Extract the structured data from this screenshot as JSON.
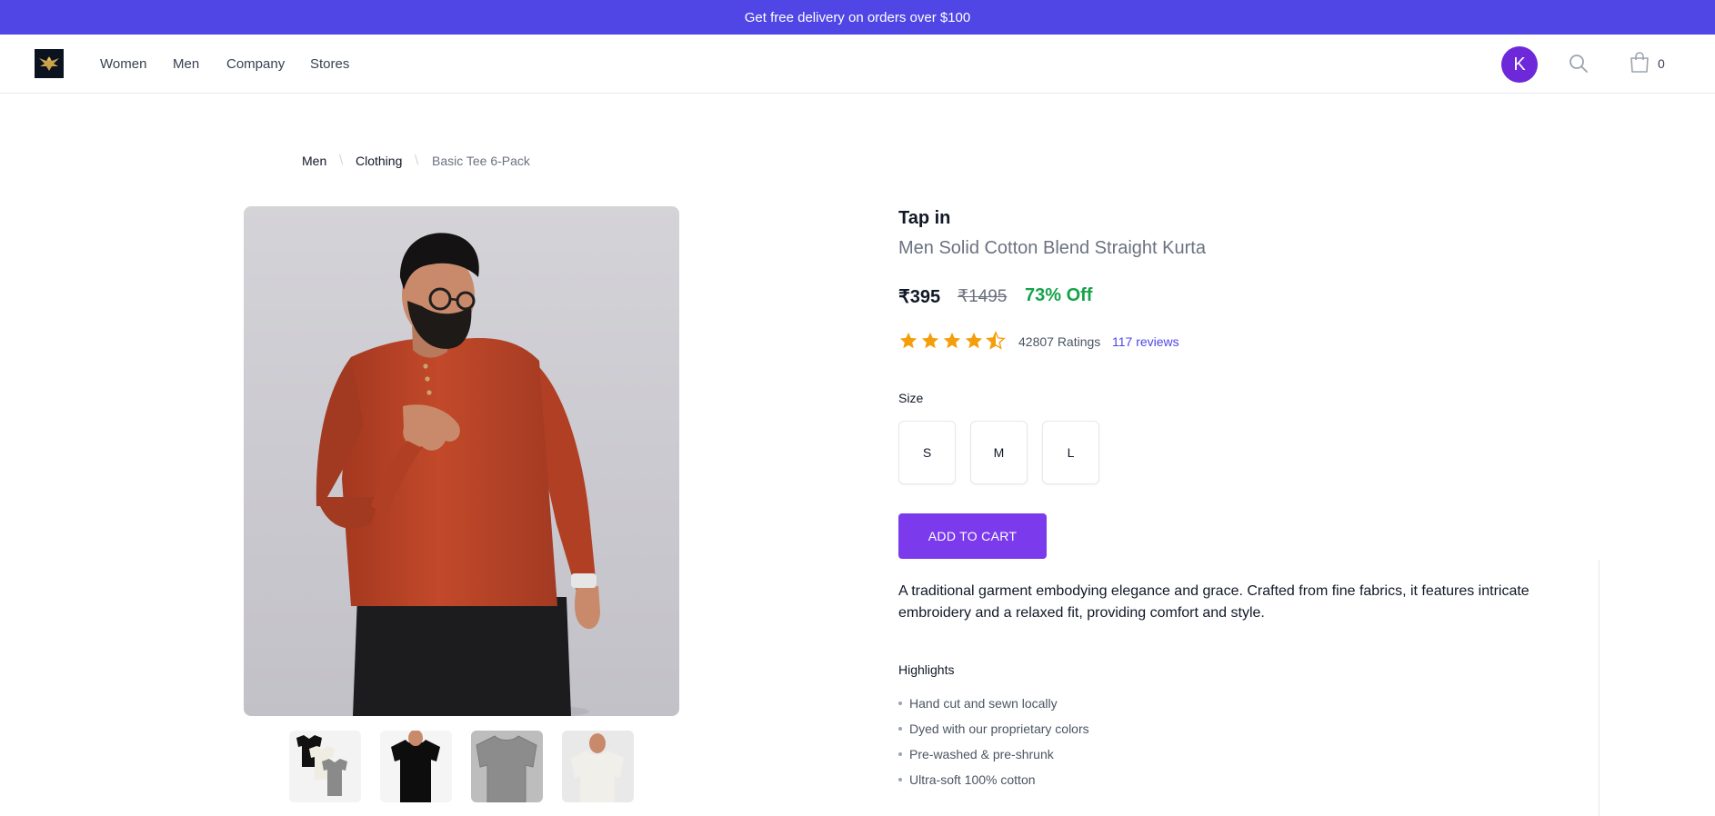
{
  "banner": {
    "text": "Get free delivery on orders over $100"
  },
  "nav": {
    "links": [
      "Women",
      "Men",
      "Company",
      "Stores"
    ],
    "avatar_initial": "K",
    "cart_count": "0"
  },
  "breadcrumb": [
    "Men",
    "Clothing",
    "Basic Tee 6-Pack"
  ],
  "product": {
    "brand": "Tap in",
    "name": "Men Solid Cotton Blend Straight Kurta",
    "price": "₹395",
    "mrp": "₹1495",
    "discount": "73% Off",
    "rating": 4.5,
    "ratings_count": "42807 Ratings",
    "reviews": "117 reviews",
    "size_label": "Size",
    "sizes": [
      "S",
      "M",
      "L"
    ],
    "add_to_cart": "ADD TO CART",
    "description": "A traditional garment embodying elegance and grace. Crafted from fine fabrics, it features intricate embroidery and a relaxed fit, providing comfort and style.",
    "highlights_title": "Highlights",
    "highlights": [
      "Hand cut and sewn locally",
      "Dyed with our proprietary colors",
      "Pre-washed & pre-shrunk",
      "Ultra-soft 100% cotton"
    ]
  },
  "colors": {
    "banner": "#4f46e5",
    "avatar": "#6d28d9",
    "button": "#7c3aed",
    "discount": "#16a34a",
    "star": "#f59e0b",
    "link": "#4f46e5"
  }
}
